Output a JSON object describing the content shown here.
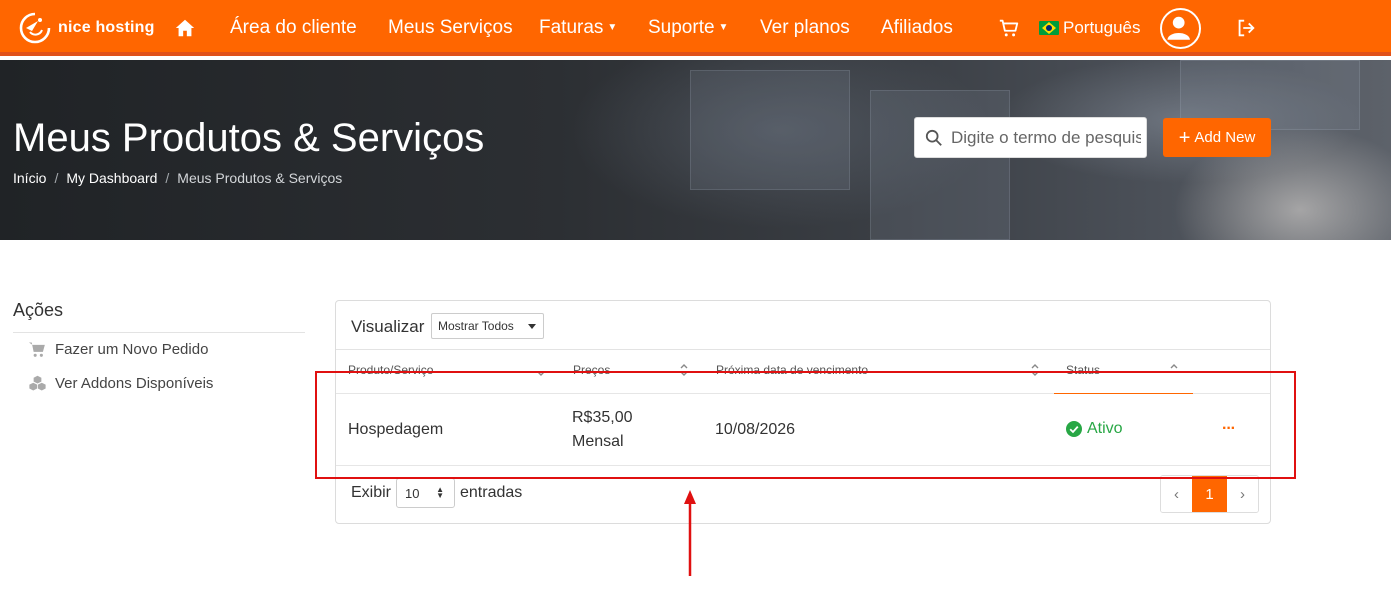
{
  "brand": {
    "name": "nice hosting",
    "accent": "#ff6600"
  },
  "nav": {
    "items": [
      {
        "label": "Área do cliente",
        "dropdown": false
      },
      {
        "label": "Meus Serviços",
        "dropdown": false
      },
      {
        "label": "Faturas",
        "dropdown": true
      },
      {
        "label": "Suporte",
        "dropdown": true
      },
      {
        "label": "Ver planos",
        "dropdown": false
      },
      {
        "label": "Afiliados",
        "dropdown": false
      }
    ],
    "language": "Português",
    "icons": [
      "home-icon",
      "cart-icon",
      "user-avatar-icon",
      "logout-icon"
    ]
  },
  "hero": {
    "title": "Meus Produtos & Serviços",
    "breadcrumb": [
      "Início",
      "My Dashboard",
      "Meus Produtos & Serviços"
    ],
    "search_placeholder": "Digite o termo de pesquisa",
    "add_new_label": "Add New"
  },
  "sidebar": {
    "title": "Ações",
    "items": [
      {
        "label": "Fazer um Novo Pedido",
        "icon": "cart-icon"
      },
      {
        "label": "Ver Addons Disponíveis",
        "icon": "cubes-icon"
      }
    ]
  },
  "table": {
    "view_label": "Visualizar",
    "view_value": "Mostrar Todos",
    "columns": [
      "Produto/Serviço",
      "Preços",
      "Próxima data de vencimento",
      "Status"
    ],
    "rows": [
      {
        "product": "Hospedagem",
        "price": "R$35,00",
        "cycle": "Mensal",
        "due": "10/08/2026",
        "status": "Ativo",
        "status_color": "#28a745"
      }
    ],
    "length_label_before": "Exibir",
    "length_value": "10",
    "length_label_after": "entradas",
    "pagination": {
      "prev": "‹",
      "current": "1",
      "next": "›"
    }
  },
  "annotation": {
    "color": "#e01010"
  }
}
